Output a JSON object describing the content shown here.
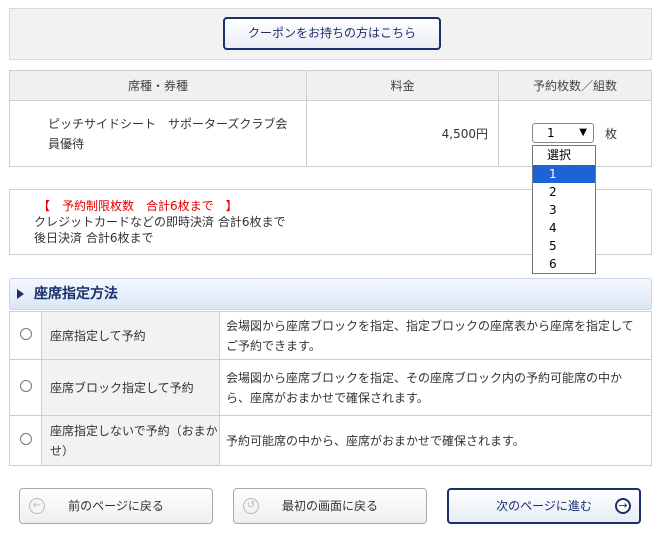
{
  "coupon": {
    "label": "クーポンをお持ちの方はこちら"
  },
  "ticket_table": {
    "headers": {
      "type": "席種・券種",
      "price": "料金",
      "qty": "予約枚数／組数"
    },
    "rows": [
      {
        "seat": "ピッチサイドシート　サポーターズクラブ会員優待",
        "price": "4,500円",
        "qty_value": "1",
        "qty_unit": "枚"
      }
    ]
  },
  "qty_dropdown": {
    "options": [
      "選択",
      "1",
      "2",
      "3",
      "4",
      "5",
      "6"
    ],
    "selected": "1"
  },
  "limits": {
    "line1": "【　予約制限枚数　合計6枚まで　】",
    "line2": "クレジットカードなどの即時決済 合計6枚まで",
    "line3": "後日決済 合計6枚まで",
    "line1_color": "#e60000"
  },
  "seat_method": {
    "title": "座席指定方法",
    "options": [
      {
        "name": "座席指定して予約",
        "desc": "会場図から座席ブロックを指定、指定ブロックの座席表から座席を指定してご予約できます。"
      },
      {
        "name": "座席ブロック指定して予約",
        "desc": "会場図から座席ブロックを指定、その座席ブロック内の予約可能席の中から、座席がおまかせで確保されます。"
      },
      {
        "name": "座席指定しないで予約（おまかせ）",
        "desc": "予約可能席の中から、座席がおまかせで確保されます。"
      }
    ]
  },
  "nav": {
    "back": "前のページに戻る",
    "first": "最初の画面に戻る",
    "next": "次のページに進む"
  },
  "colors": {
    "accent": "#1b2f6b",
    "selected_option": "#1e63d6",
    "section_bg": "#dbe6f6"
  }
}
